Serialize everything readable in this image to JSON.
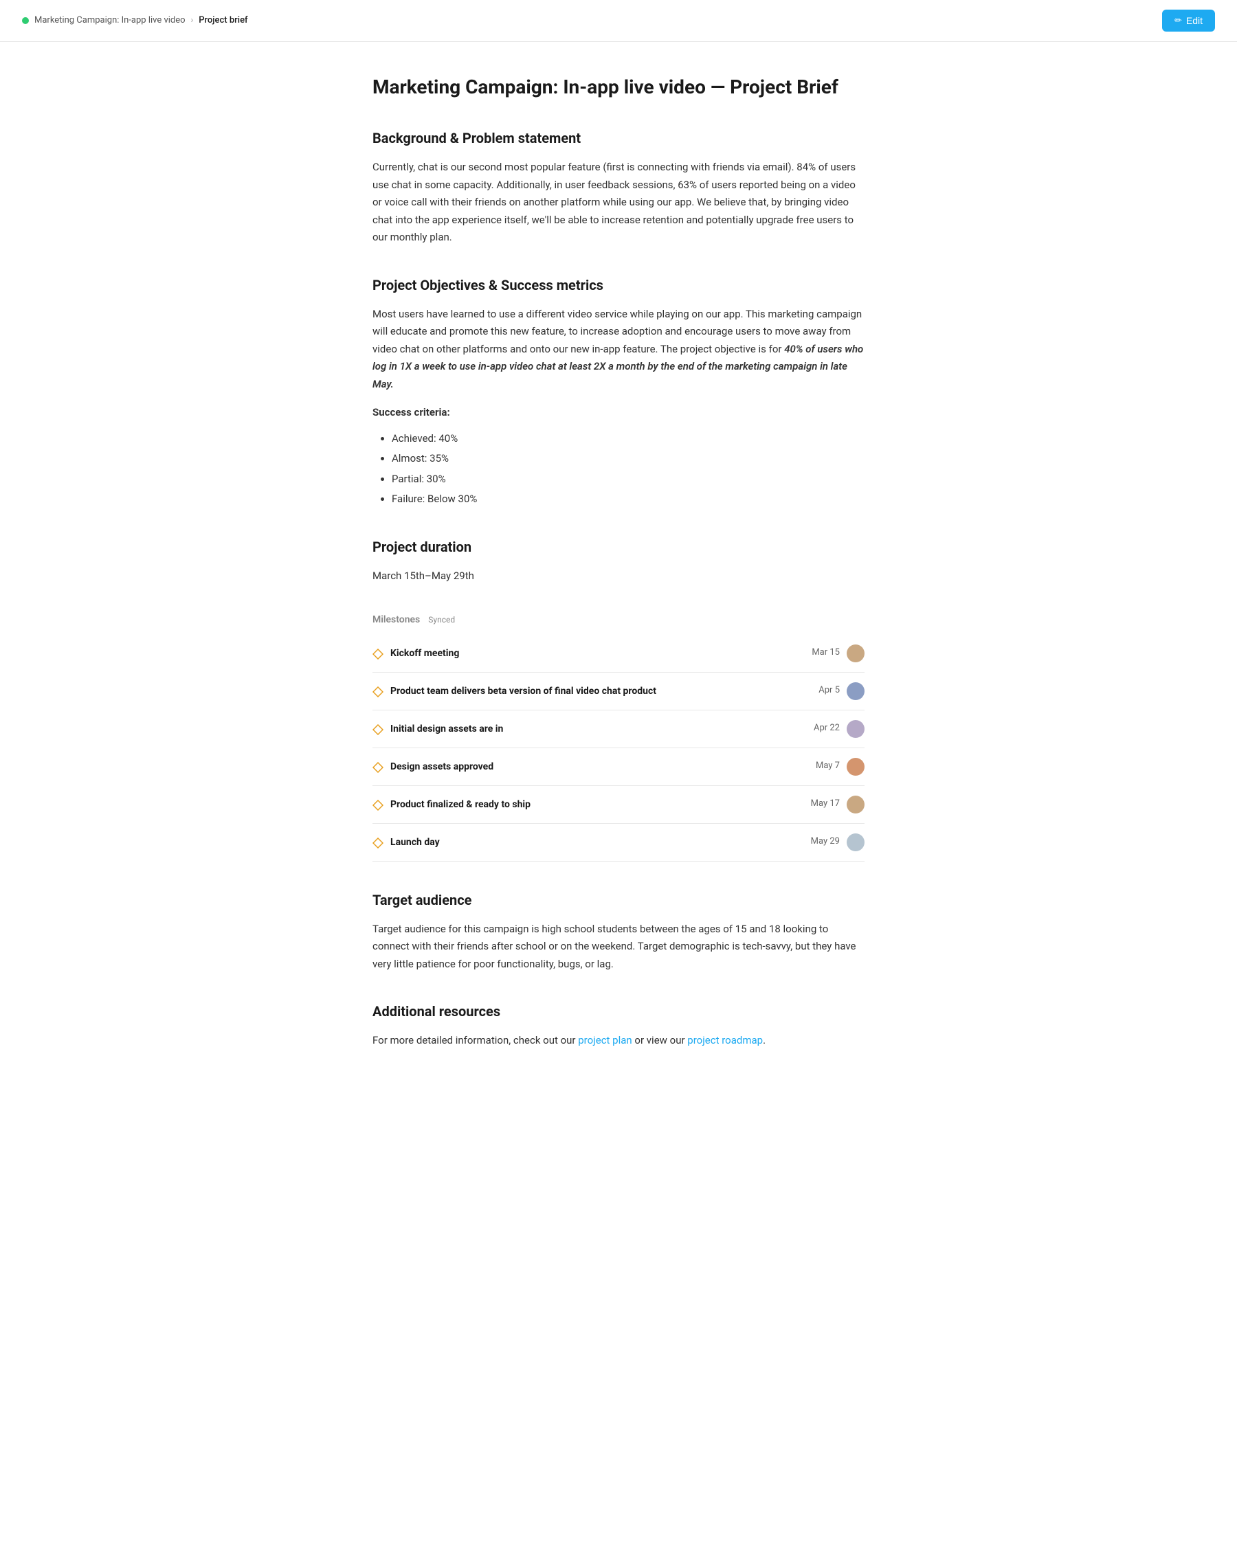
{
  "nav": {
    "parent_label": "Marketing Campaign: In-app live video",
    "chevron": "›",
    "current_label": "Project brief",
    "edit_button_label": "Edit",
    "edit_icon": "✏"
  },
  "page": {
    "title": "Marketing Campaign: In-app live video — Project Brief",
    "sections": {
      "background": {
        "heading": "Background & Problem statement",
        "body": "Currently, chat is our second most popular feature (first is connecting with friends via email). 84% of users use chat in some capacity. Additionally, in user feedback sessions, 63% of users reported being on a video or voice call with their friends on another platform while using our app. We believe that, by bringing video chat into the app experience itself, we'll be able to increase retention and potentially upgrade free users to our monthly plan."
      },
      "objectives": {
        "heading": "Project Objectives & Success metrics",
        "body_intro": "Most users have learned to use a different video service while playing on our app. This marketing campaign will educate and promote this new feature, to increase adoption and encourage users to move away from video chat on other platforms and onto our new in-app feature. The project objective is for",
        "body_italic": "40% of users who log in 1X a week to use in-app video chat at least 2X a month by the end of the marketing campaign in late May.",
        "success_criteria_label": "Success criteria:",
        "success_criteria": [
          "Achieved: 40%",
          "Almost: 35%",
          "Partial: 30%",
          "Failure: Below 30%"
        ]
      },
      "duration": {
        "heading": "Project duration",
        "body": "March 15th–May 29th"
      },
      "milestones": {
        "heading": "Milestones",
        "synced_label": "Synced",
        "items": [
          {
            "name": "Kickoff meeting",
            "date": "Mar 15",
            "avatar_class": "avatar-1"
          },
          {
            "name": "Product team delivers beta version of final video chat product",
            "date": "Apr 5",
            "avatar_class": "avatar-2"
          },
          {
            "name": "Initial design assets are in",
            "date": "Apr 22",
            "avatar_class": "avatar-3"
          },
          {
            "name": "Design assets approved",
            "date": "May 7",
            "avatar_class": "avatar-4"
          },
          {
            "name": "Product finalized & ready to ship",
            "date": "May 17",
            "avatar_class": "avatar-5"
          },
          {
            "name": "Launch day",
            "date": "May 29",
            "avatar_class": "avatar-6"
          }
        ]
      },
      "target_audience": {
        "heading": "Target audience",
        "body": "Target audience for this campaign is high school students between the ages of 15 and 18 looking to connect with their friends after school or on the weekend. Target demographic is tech-savvy, but they have very little patience for poor functionality, bugs, or lag."
      },
      "additional_resources": {
        "heading": "Additional resources",
        "body_prefix": "For more detailed information, check out our",
        "link1_label": "project plan",
        "body_middle": "or view our",
        "link2_label": "project roadmap",
        "body_suffix": "."
      }
    }
  }
}
